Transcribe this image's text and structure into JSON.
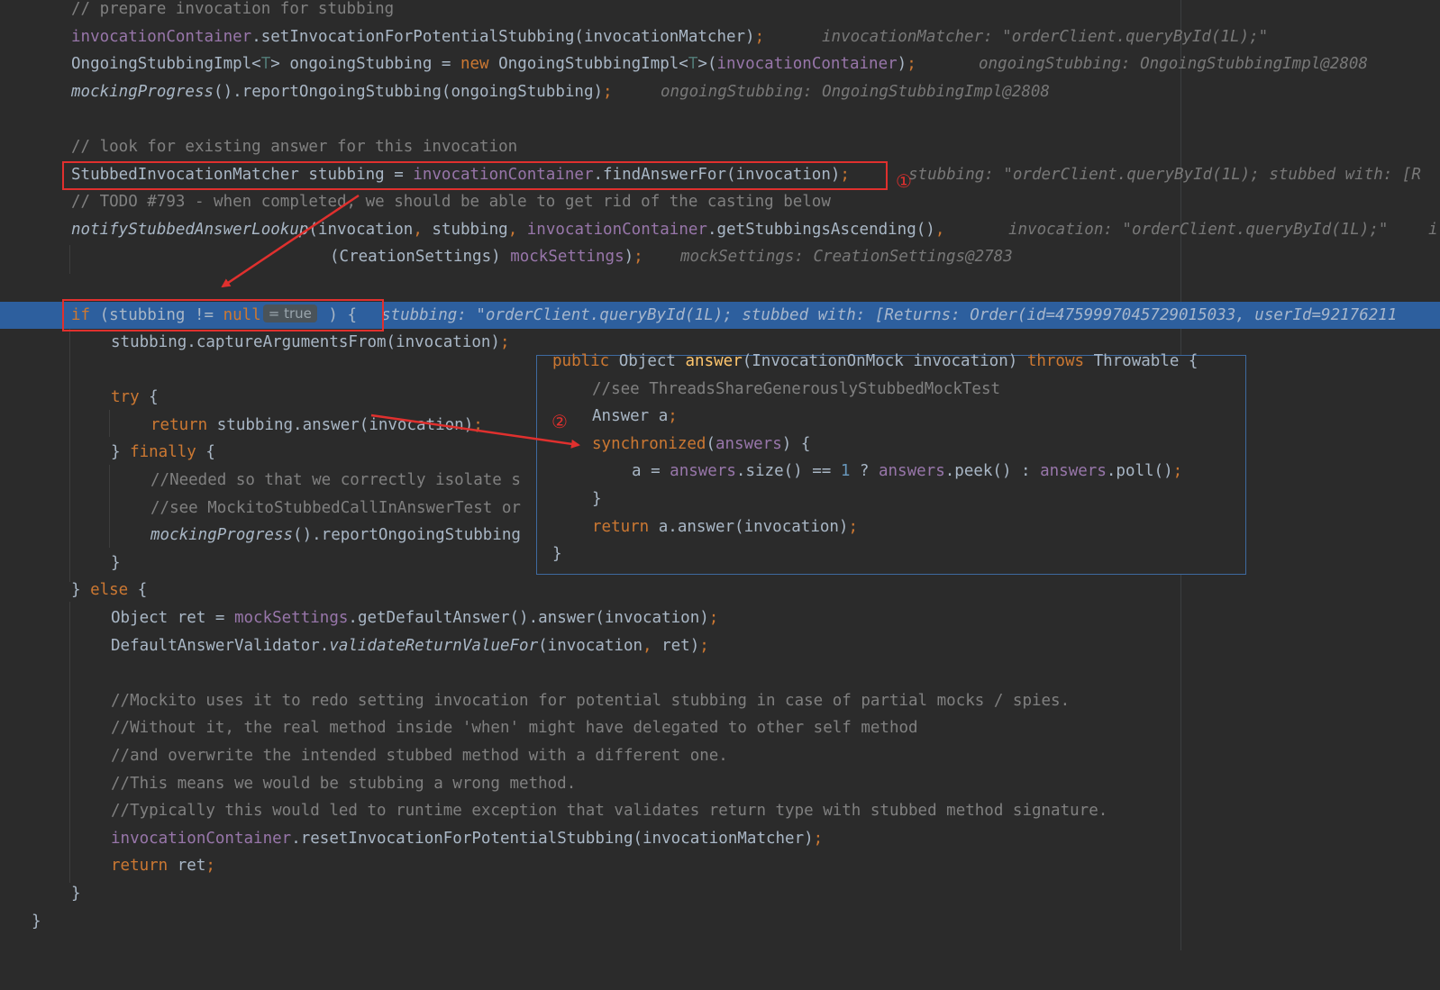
{
  "editor": {
    "lines": {
      "l0": {
        "comment": "// prepare invocation for stubbing"
      },
      "l1": {
        "field": "invocationContainer",
        "call": ".setInvocationForPotentialStubbing(invocationMatcher)",
        "semi": ";",
        "hint": "invocationMatcher: \"orderClient.queryById(1L);\""
      },
      "l2": {
        "type": "OngoingStubbingImpl<",
        "gen": "T",
        "type2": "> ongoingStubbing = ",
        "kw": "new",
        "type3": " OngoingStubbingImpl<",
        "gen2": "T",
        "type4": ">(",
        "field": "invocationContainer",
        "close": ")",
        "semi": ";",
        "hint": "ongoingStubbing: OngoingStubbingImpl@2808"
      },
      "l3": {
        "method": "mockingProgress",
        "rest": "().reportOngoingStubbing(ongoingStubbing)",
        "semi": ";",
        "hint": "ongoingStubbing: OngoingStubbingImpl@2808"
      },
      "l5": {
        "comment": "// look for existing answer for this invocation"
      },
      "l6": {
        "pre": "StubbedInvocationMatcher stubbing = ",
        "field": "invocationContainer",
        "rest": ".findAnswerFor(invocation)",
        "semi": ";",
        "hint": "stubbing: \"orderClient.queryById(1L); stubbed with: [R"
      },
      "l7": {
        "comment": "// TODO #793 - when completed, we should be able to get rid of the casting below"
      },
      "l8": {
        "method": "notifyStubbedAnswerLookup",
        "pre": "(invocation",
        "c1": ",",
        "mid": " stubbing",
        "c2": ",",
        "field": " invocationContainer",
        "rest": ".getStubbingsAscending()",
        "c3": ",",
        "hint": "invocation: \"orderClient.queryById(1L);\"",
        "hint2": "i"
      },
      "l9": {
        "pre": "(CreationSettings) ",
        "field": "mockSettings",
        "close": ")",
        "semi": ";",
        "hint": "mockSettings: CreationSettings@2783"
      },
      "l11": {
        "kw": "if",
        "pre": " (stubbing != ",
        "kw2": "null",
        "inlay": "= true",
        "post": " ) {",
        "hint": "stubbing: \"orderClient.queryById(1L); stubbed with: [Returns: Order(id=4759997045729015033, userId=92176211"
      },
      "l12": {
        "text": "stubbing.captureArgumentsFrom(invocation)",
        "semi": ";"
      },
      "l14": {
        "kw": "try",
        "post": " {"
      },
      "l15": {
        "kw": "return",
        "post": " stubbing.answer(invocation)",
        "semi": ";"
      },
      "l16": {
        "pre": "} ",
        "kw": "finally",
        "post": " {"
      },
      "l17": {
        "comment": "//Needed so that we correctly isolate s"
      },
      "l18": {
        "comment": "//see MockitoStubbedCallInAnswerTest or"
      },
      "l19": {
        "method": "mockingProgress",
        "rest": "().reportOngoingStubbing"
      },
      "l20": {
        "text": "}"
      },
      "l21": {
        "pre": "} ",
        "kw": "else",
        "post": " {"
      },
      "l22": {
        "pre": "Object ret = ",
        "field": "mockSettings",
        "rest": ".getDefaultAnswer().answer(invocation)",
        "semi": ";"
      },
      "l23": {
        "pre": "DefaultAnswerValidator.",
        "method": "validateReturnValueFor",
        "rest": "(invocation",
        "c1": ",",
        "post": " ret)",
        "semi": ";"
      },
      "l25": {
        "comment": "//Mockito uses it to redo setting invocation for potential stubbing in case of partial mocks / spies."
      },
      "l26": {
        "comment": "//Without it, the real method inside 'when' might have delegated to other self method"
      },
      "l27": {
        "comment": "//and overwrite the intended stubbed method with a different one."
      },
      "l28": {
        "comment": "//This means we would be stubbing a wrong method."
      },
      "l29": {
        "comment": "//Typically this would led to runtime exception that validates return type with stubbed method signature."
      },
      "l30": {
        "field": "invocationContainer",
        "rest": ".resetInvocationForPotentialStubbing(invocationMatcher)",
        "semi": ";"
      },
      "l31": {
        "kw": "return",
        "post": " ret",
        "semi": ";"
      },
      "l32": {
        "text": "}"
      },
      "l33": {
        "text": "}"
      }
    }
  },
  "popup": {
    "p0": {
      "kw": "public",
      "t1": " Object ",
      "fn": "answer",
      "t2": "(InvocationOnMock invocation) ",
      "kw2": "throws",
      "t3": " Throwable {"
    },
    "p1": {
      "comment": "//see ThreadsShareGenerouslyStubbedMockTest"
    },
    "p2": {
      "text": "Answer a",
      "semi": ";"
    },
    "p3": {
      "kw": "synchronized",
      "t1": "(",
      "field": "answers",
      "t2": ") {"
    },
    "p4": {
      "t1": "a = ",
      "field": "answers",
      "t2": ".size() == ",
      "num": "1",
      "t3": " ? ",
      "field2": "answers",
      "t4": ".peek() : ",
      "field3": "answers",
      "t5": ".poll()",
      "semi": ";"
    },
    "p5": {
      "text": "}"
    },
    "p6": {
      "kw": "return",
      "t1": " a.answer(invocation)",
      "semi": ";"
    },
    "p7": {
      "text": "}"
    }
  },
  "annotations": {
    "marker1": "①",
    "marker2": "②",
    "annotation_color": "#e0302e"
  },
  "colors": {
    "background": "#2b2b2b",
    "execution_line": "#2d5f9e",
    "keyword": "#cc7832",
    "field": "#9876aa",
    "method_decl": "#ffc66d",
    "comment": "#808080",
    "number": "#6897bb"
  }
}
